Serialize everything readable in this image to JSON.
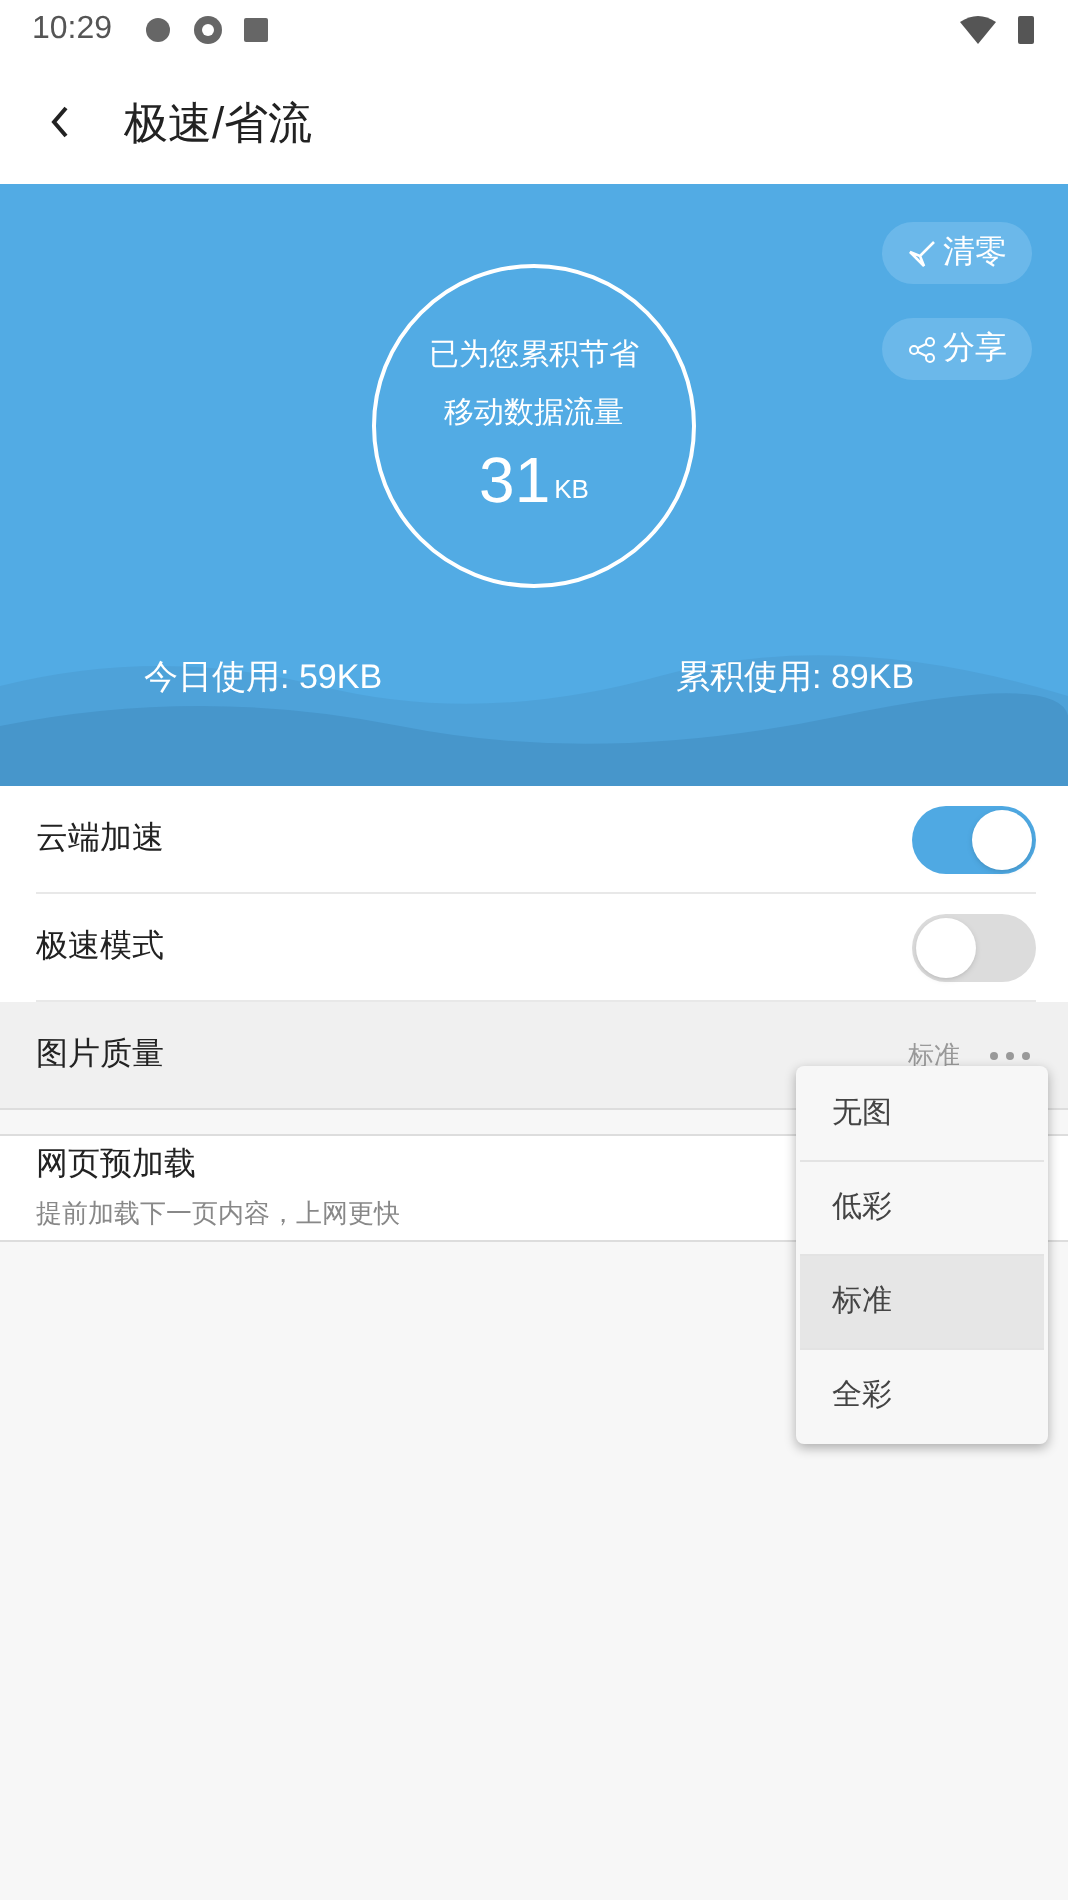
{
  "status_bar": {
    "time": "10:29"
  },
  "header": {
    "title": "极速/省流"
  },
  "banner": {
    "saved_line_1": "已为您累积节省",
    "saved_line_2": "移动数据流量",
    "saved_value": "31",
    "saved_unit": "KB",
    "buttons": [
      {
        "kind": "clear",
        "label": "清零"
      },
      {
        "kind": "share",
        "label": "分享"
      }
    ],
    "today": "今日使用: 59KB",
    "total": "累积使用: 89KB"
  },
  "settings": [
    {
      "kind": "toggle",
      "label": "云端加速",
      "on": true
    },
    {
      "kind": "toggle",
      "label": "极速模式",
      "on": false
    },
    {
      "kind": "select",
      "label": "图片质量",
      "value": "标准"
    },
    {
      "kind": "info",
      "label": "网页预加载",
      "description": "提前加载下一页内容，上网更快"
    }
  ],
  "menu": [
    {
      "label": "无图",
      "selected": false
    },
    {
      "label": "低彩",
      "selected": false
    },
    {
      "label": "标准",
      "selected": true
    },
    {
      "label": "全彩",
      "selected": false
    }
  ]
}
